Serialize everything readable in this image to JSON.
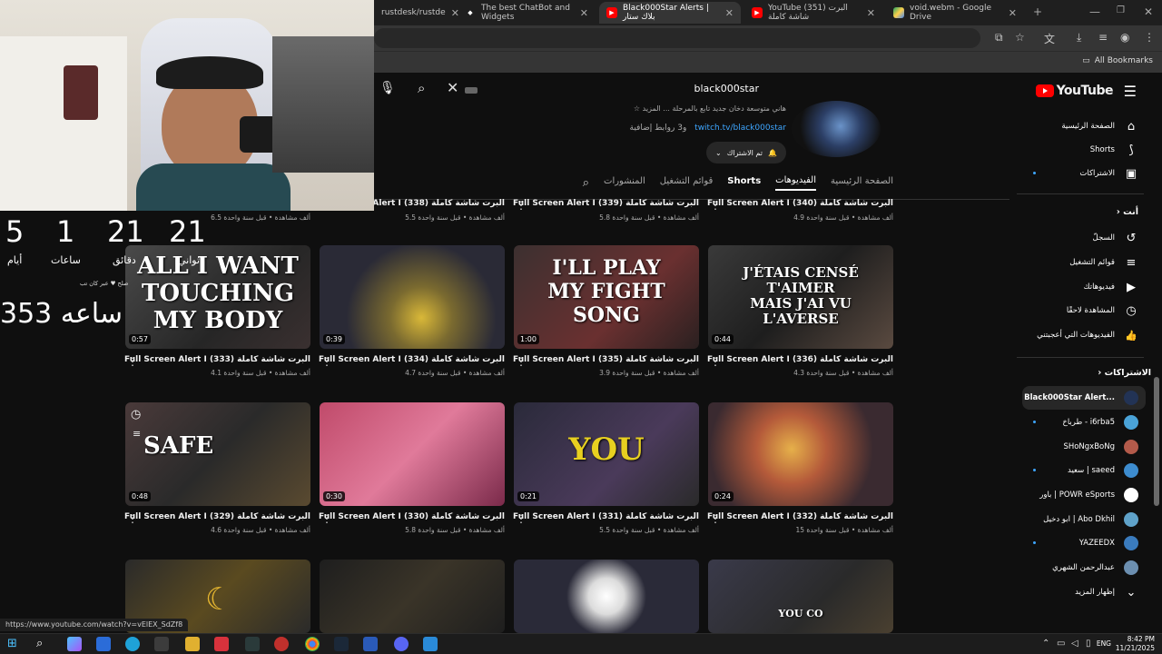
{
  "browser": {
    "tabs": [
      {
        "label": "rustdesk/rustde",
        "active": false
      },
      {
        "label": "The best ChatBot and Widgets",
        "active": false
      },
      {
        "label": "Black000Star Alerts | بلاك ستار",
        "active": true
      },
      {
        "label": "YouTube (351) البرت شاشة كاملة",
        "active": false
      },
      {
        "label": "void.webm - Google Drive",
        "active": false
      }
    ],
    "new_tab": "+",
    "all_bookmarks": "All Bookmarks"
  },
  "youtube": {
    "logo_text": "YouTube",
    "search_query": "black000star",
    "channel": {
      "description": "☆ هاني متوسعة دخان جديد تابع بالمرحلة ... المزيد",
      "link_url": "twitch.tv/black000star",
      "link_more": "و3 روابط إضافية",
      "subscribe_label": "تم الاشتراك"
    },
    "tabs": [
      {
        "label": "الصفحة الرئيسية",
        "state": "normal"
      },
      {
        "label": "الفيديوهات",
        "state": "active"
      },
      {
        "label": "Shorts",
        "state": "bold"
      },
      {
        "label": "قوائم التشغيل",
        "state": "normal"
      },
      {
        "label": "المنشورات",
        "state": "normal"
      }
    ],
    "top_row": [
      {
        "title": "Full Screen Alert I (340) البرت شاشة كاملة",
        "meta": "4.9 ألف مشاهدة • قبل سنة واحدة"
      },
      {
        "title": "Full Screen Alert I (339) البرت شاشة كاملة",
        "meta": "5.8 ألف مشاهدة • قبل سنة واحدة"
      },
      {
        "title": "Full Screen Alert I (338) البرت شاشة كاملة",
        "meta": "5.5 ألف مشاهدة • قبل سنة واحدة"
      },
      {
        "title": "",
        "meta": "6.5 ألف مشاهدة • قبل سنة واحدة"
      }
    ],
    "row1": [
      {
        "duration": "0:57",
        "title": "Full Screen Alert I (333) البرت شاشة كاملة",
        "meta": "4.1 ألف مشاهدة • قبل سنة واحدة",
        "thumb_text": "ALL I WANT\nTOUCHING\nMY BODY"
      },
      {
        "duration": "0:39",
        "title": "Full Screen Alert I (334) البرت شاشة كاملة",
        "meta": "4.7 ألف مشاهدة • قبل سنة واحدة",
        "thumb_text": ""
      },
      {
        "duration": "1:00",
        "title": "Full Screen Alert I (335) البرت شاشة كاملة",
        "meta": "3.9 ألف مشاهدة • قبل سنة واحدة",
        "thumb_text": "I'LL PLAY\nMY FIGHT\nSONG"
      },
      {
        "duration": "0:44",
        "title": "Full Screen Alert I (336) البرت شاشة كاملة",
        "meta": "4.3 ألف مشاهدة • قبل سنة واحدة",
        "thumb_text": "J'ÉTAIS CENSÉ\nT'AIMER\nMAIS J'AI VU\nL'AVERSE"
      }
    ],
    "row2": [
      {
        "duration": "0:48",
        "title": "Full Screen Alert I (329) البرت شاشة كاملة",
        "meta": "4.6 ألف مشاهدة • قبل سنة واحدة",
        "thumb_text": "SAFE"
      },
      {
        "duration": "0:30",
        "title": "Full Screen Alert I (330) البرت شاشة كاملة",
        "meta": "5.8 ألف مشاهدة • قبل سنة واحدة",
        "thumb_text": ""
      },
      {
        "duration": "0:21",
        "title": "Full Screen Alert I (331) البرت شاشة كاملة",
        "meta": "5.5 ألف مشاهدة • قبل سنة واحدة",
        "thumb_text": "YOU"
      },
      {
        "duration": "0:24",
        "title": "Full Screen Alert I (332) البرت شاشة كاملة",
        "meta": "15 ألف مشاهدة • قبل سنة واحدة",
        "thumb_text": ""
      }
    ],
    "row3": [
      {
        "thumb_text": ""
      },
      {
        "thumb_text": ""
      },
      {
        "thumb_text": ""
      },
      {
        "thumb_text": "YOU CO"
      }
    ],
    "sidebar": {
      "main": [
        {
          "label": "الصفحة الرئيسية",
          "icon": "home-icon",
          "glyph": "⌂"
        },
        {
          "label": "Shorts",
          "icon": "shorts-icon",
          "glyph": "⟆"
        },
        {
          "label": "الاشتراكات",
          "icon": "subscriptions-icon",
          "glyph": "▣"
        }
      ],
      "you_heading": "أنت",
      "you": [
        {
          "label": "السجلّ",
          "icon": "history-icon",
          "glyph": "↺"
        },
        {
          "label": "قوائم التشغيل",
          "icon": "playlists-icon",
          "glyph": "≡"
        },
        {
          "label": "فيديوهاتك",
          "icon": "your-videos-icon",
          "glyph": "▶"
        },
        {
          "label": "المشاهدة لاحقًا",
          "icon": "watch-later-icon",
          "glyph": "◷"
        },
        {
          "label": "الفيديوهات التي أعجبتني",
          "icon": "liked-icon",
          "glyph": "👍"
        }
      ],
      "subs_heading": "الاشتراكات",
      "subs": [
        {
          "label": "Black000Star Alert...",
          "color": "#223355",
          "active": true,
          "dot": false
        },
        {
          "label": "طرباخ - i6rba5",
          "color": "#4aa3d8",
          "active": false,
          "dot": true
        },
        {
          "label": "SHoNgxBoNg",
          "color": "#b35a4a",
          "active": false,
          "dot": false
        },
        {
          "label": "سعيد | saeed",
          "color": "#3d8ccf",
          "active": false,
          "dot": true
        },
        {
          "label": "باور | POWR eSports",
          "color": "#ffffff",
          "active": false,
          "dot": false
        },
        {
          "label": "ابو دخيل | Abo Dkhil",
          "color": "#5fa2c9",
          "active": false,
          "dot": false
        },
        {
          "label": "YAZEEDX",
          "color": "#3a7bbd",
          "active": false,
          "dot": true
        },
        {
          "label": "عبدالرحمن الشهري",
          "color": "#6c8fb0",
          "active": false,
          "dot": false
        }
      ],
      "show_more": "إظهار المزيد"
    }
  },
  "overlay": {
    "counters": [
      {
        "value": "5",
        "label": "أيام"
      },
      {
        "value": "1",
        "label": "ساعات"
      },
      {
        "value": "21",
        "label": "دقائق"
      },
      {
        "value": "21",
        "label": "ثواني"
      }
    ],
    "note": "صلح ♥ عبر كان تب",
    "big_count": "353 ساعه"
  },
  "status_url": "https://www.youtube.com/watch?v=vElEX_SdZf8",
  "taskbar": {
    "lang": "ENG",
    "time": "8:42 PM",
    "date": "11/21/2025"
  }
}
